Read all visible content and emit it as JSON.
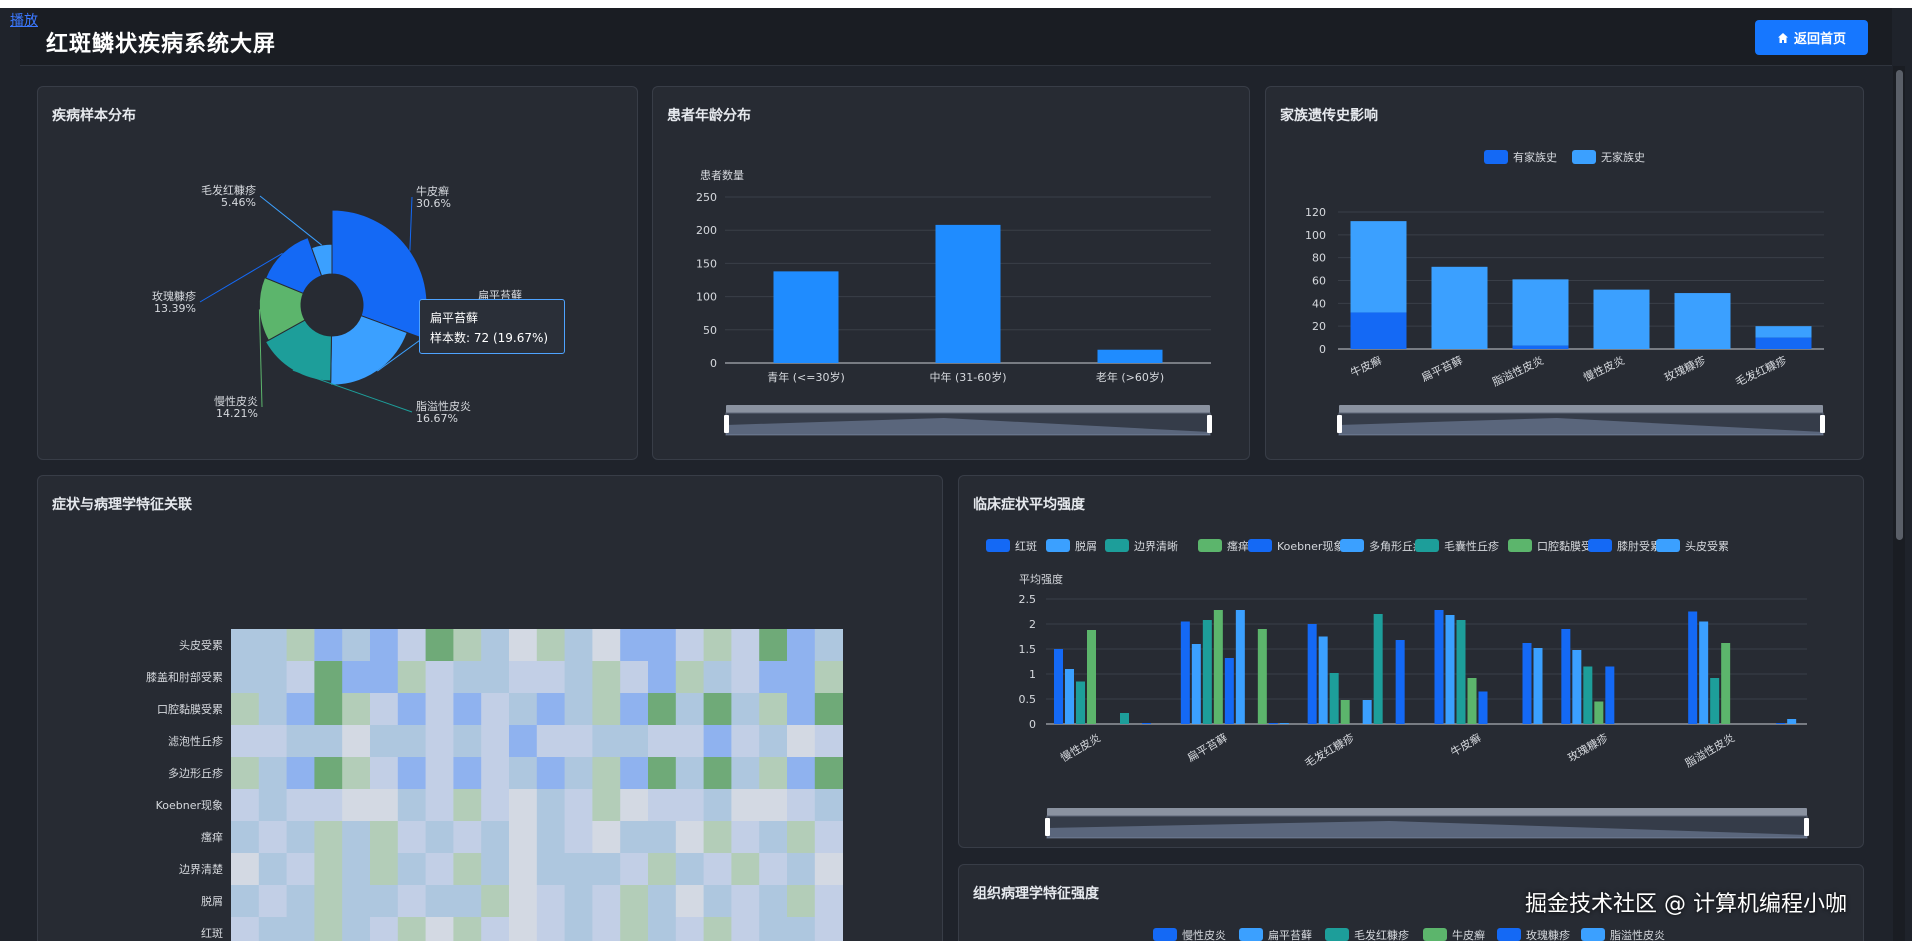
{
  "overlay": {
    "play_link": "播放",
    "watermark": "掘金技术社区 @ 计算机编程小咖"
  },
  "header": {
    "title": "红斑鳞状疾病系统大屏",
    "home_button": "返回首页"
  },
  "colors": {
    "accent": "#1677ff",
    "blue_dark": "#1469f5",
    "blue_light": "#3ba0ff",
    "teal": "#1d9e9a",
    "green": "#5cb56c",
    "panel_bg": "#272b33"
  },
  "panels": {
    "disease_dist": {
      "title": "疾病样本分布"
    },
    "age_dist": {
      "title": "患者年龄分布"
    },
    "family_history": {
      "title": "家族遗传史影响"
    },
    "heatmap": {
      "title": "症状与病理学特征关联"
    },
    "clinical": {
      "title": "临床症状平均强度"
    },
    "histo": {
      "title": "组织病理学特征强度"
    }
  },
  "tooltip": {
    "title": "扁平苔藓",
    "value": "样本数: 72 (19.67%)"
  },
  "chart_data": [
    {
      "id": "disease_pie",
      "type": "pie",
      "title": "疾病样本分布",
      "slices": [
        {
          "name": "牛皮癣",
          "value": 30.6,
          "label": "30.6%",
          "color": "#1469f5"
        },
        {
          "name": "扁平苔藓",
          "value": 19.67,
          "label": "",
          "color": "#3ba0ff"
        },
        {
          "name": "脂溢性皮炎",
          "value": 16.67,
          "label": "16.67%",
          "color": "#1d9e9a"
        },
        {
          "name": "慢性皮炎",
          "value": 14.21,
          "label": "14.21%",
          "color": "#5cb56c"
        },
        {
          "name": "玫瑰糠疹",
          "value": 13.39,
          "label": "13.39%",
          "color": "#1469f5"
        },
        {
          "name": "毛发红糠疹",
          "value": 5.46,
          "label": "5.46%",
          "color": "#3ba0ff"
        }
      ]
    },
    {
      "id": "age_bar",
      "type": "bar",
      "title": "患者年龄分布",
      "ylabel": "患者数量",
      "categories": [
        "青年 (<=30岁)",
        "中年 (31-60岁)",
        "老年 (>60岁)"
      ],
      "values": [
        138,
        208,
        20
      ],
      "yticks": [
        0,
        50,
        100,
        150,
        200,
        250
      ],
      "ylim": [
        0,
        250
      ]
    },
    {
      "id": "family_bar",
      "type": "bar",
      "title": "家族遗传史影响",
      "stacked": true,
      "categories": [
        "牛皮癣",
        "扁平苔藓",
        "脂溢性皮炎",
        "慢性皮炎",
        "玫瑰糠疹",
        "毛发红糠疹"
      ],
      "series": [
        {
          "name": "有家族史",
          "values": [
            32,
            0,
            3,
            0,
            0,
            10
          ],
          "color": "#1469f5"
        },
        {
          "name": "无家族史",
          "values": [
            80,
            72,
            58,
            52,
            49,
            10
          ],
          "color": "#3ba0ff"
        }
      ],
      "yticks": [
        0,
        20,
        40,
        60,
        80,
        100,
        120
      ],
      "ylim": [
        0,
        120
      ],
      "legend": "top-center"
    },
    {
      "id": "heatmap",
      "type": "heatmap",
      "title": "症状与病理学特征关联",
      "rows": [
        "头皮受累",
        "膝盖和肘部受累",
        "口腔黏膜受累",
        "滤泡性丘疹",
        "多边形丘疹",
        "Koebner现象",
        "瘙痒",
        "边界清楚",
        "脱屑",
        "红斑"
      ],
      "cols": 22,
      "values": [
        [
          2,
          2,
          3,
          4,
          2,
          4,
          1,
          5,
          3,
          2,
          0,
          3,
          2,
          0,
          4,
          4,
          1,
          3,
          1,
          5,
          4,
          2
        ],
        [
          2,
          2,
          1,
          5,
          4,
          4,
          3,
          1,
          2,
          2,
          1,
          1,
          2,
          3,
          1,
          4,
          3,
          2,
          1,
          4,
          4,
          3
        ],
        [
          3,
          2,
          4,
          5,
          3,
          1,
          4,
          1,
          4,
          1,
          2,
          4,
          2,
          3,
          4,
          5,
          2,
          5,
          2,
          3,
          4,
          5
        ],
        [
          1,
          1,
          2,
          2,
          0,
          2,
          2,
          1,
          2,
          1,
          4,
          1,
          1,
          2,
          2,
          1,
          1,
          4,
          1,
          2,
          0,
          1
        ],
        [
          3,
          2,
          4,
          5,
          3,
          1,
          4,
          1,
          4,
          1,
          2,
          4,
          2,
          3,
          4,
          5,
          2,
          5,
          2,
          3,
          4,
          5
        ],
        [
          1,
          2,
          1,
          1,
          0,
          0,
          2,
          1,
          3,
          1,
          0,
          2,
          1,
          3,
          0,
          1,
          1,
          2,
          0,
          0,
          1,
          2
        ],
        [
          2,
          1,
          2,
          3,
          2,
          3,
          1,
          2,
          1,
          2,
          0,
          2,
          1,
          0,
          2,
          2,
          0,
          3,
          1,
          2,
          3,
          1
        ],
        [
          0,
          2,
          1,
          3,
          2,
          3,
          2,
          1,
          3,
          2,
          0,
          2,
          2,
          2,
          1,
          3,
          2,
          1,
          3,
          1,
          2,
          0
        ],
        [
          2,
          1,
          2,
          3,
          2,
          2,
          1,
          2,
          2,
          3,
          0,
          1,
          2,
          1,
          3,
          2,
          0,
          2,
          1,
          2,
          3,
          1
        ],
        [
          1,
          2,
          2,
          3,
          2,
          1,
          3,
          0,
          3,
          1,
          0,
          1,
          2,
          1,
          3,
          2,
          1,
          3,
          1,
          2,
          2,
          1
        ]
      ]
    },
    {
      "id": "clinical_bar",
      "type": "bar",
      "title": "临床症状平均强度",
      "ylabel": "平均强度",
      "categories": [
        "慢性皮炎",
        "扁平苔藓",
        "毛发红糠疹",
        "牛皮癣",
        "玫瑰糠疹",
        "脂溢性皮炎"
      ],
      "series": [
        {
          "name": "红斑",
          "values": [
            1.5,
            2.05,
            2.0,
            2.28,
            1.9,
            2.25
          ],
          "color": "#1469f5"
        },
        {
          "name": "脱屑",
          "values": [
            1.1,
            1.6,
            1.75,
            2.18,
            1.48,
            2.05
          ],
          "color": "#3ba0ff"
        },
        {
          "name": "边界清晰",
          "values": [
            0.85,
            2.08,
            1.02,
            2.08,
            1.15,
            0.92
          ],
          "color": "#1d9e9a"
        },
        {
          "name": "瘙痒",
          "values": [
            1.88,
            2.28,
            0.48,
            0.92,
            0.45,
            1.62
          ],
          "color": "#5cb56c"
        },
        {
          "name": "Koebner现象",
          "values": [
            0,
            1.32,
            0,
            0.65,
            1.15,
            0
          ],
          "color": "#1469f5"
        },
        {
          "name": "多角形丘疹",
          "values": [
            0,
            2.28,
            0.48,
            0,
            0,
            0
          ],
          "color": "#3ba0ff"
        },
        {
          "name": "毛囊性丘疹",
          "values": [
            0.22,
            0,
            2.2,
            0,
            0,
            0
          ],
          "color": "#1d9e9a"
        },
        {
          "name": "口腔黏膜受累",
          "values": [
            0,
            1.9,
            0,
            0,
            0,
            0
          ],
          "color": "#5cb56c"
        },
        {
          "name": "膝肘受累",
          "values": [
            0.02,
            0.02,
            1.68,
            1.62,
            0,
            0.02
          ],
          "color": "#1469f5"
        },
        {
          "name": "头皮受累",
          "values": [
            0,
            0.02,
            0,
            1.52,
            0,
            0.1
          ],
          "color": "#3ba0ff"
        }
      ],
      "yticks": [
        0,
        0.5,
        1,
        1.5,
        2,
        2.5
      ],
      "ylim": [
        0,
        2.5
      ],
      "legend": "top"
    },
    {
      "id": "histo_bar",
      "type": "bar",
      "title": "组织病理学特征强度",
      "series": [
        {
          "name": "慢性皮炎",
          "color": "#1469f5"
        },
        {
          "name": "扁平苔藓",
          "color": "#3ba0ff"
        },
        {
          "name": "毛发红糠疹",
          "color": "#1d9e9a"
        },
        {
          "name": "牛皮癣",
          "color": "#5cb56c"
        },
        {
          "name": "玫瑰糠疹",
          "color": "#1469f5"
        },
        {
          "name": "脂溢性皮炎",
          "color": "#3ba0ff"
        }
      ],
      "legend": "top"
    }
  ]
}
